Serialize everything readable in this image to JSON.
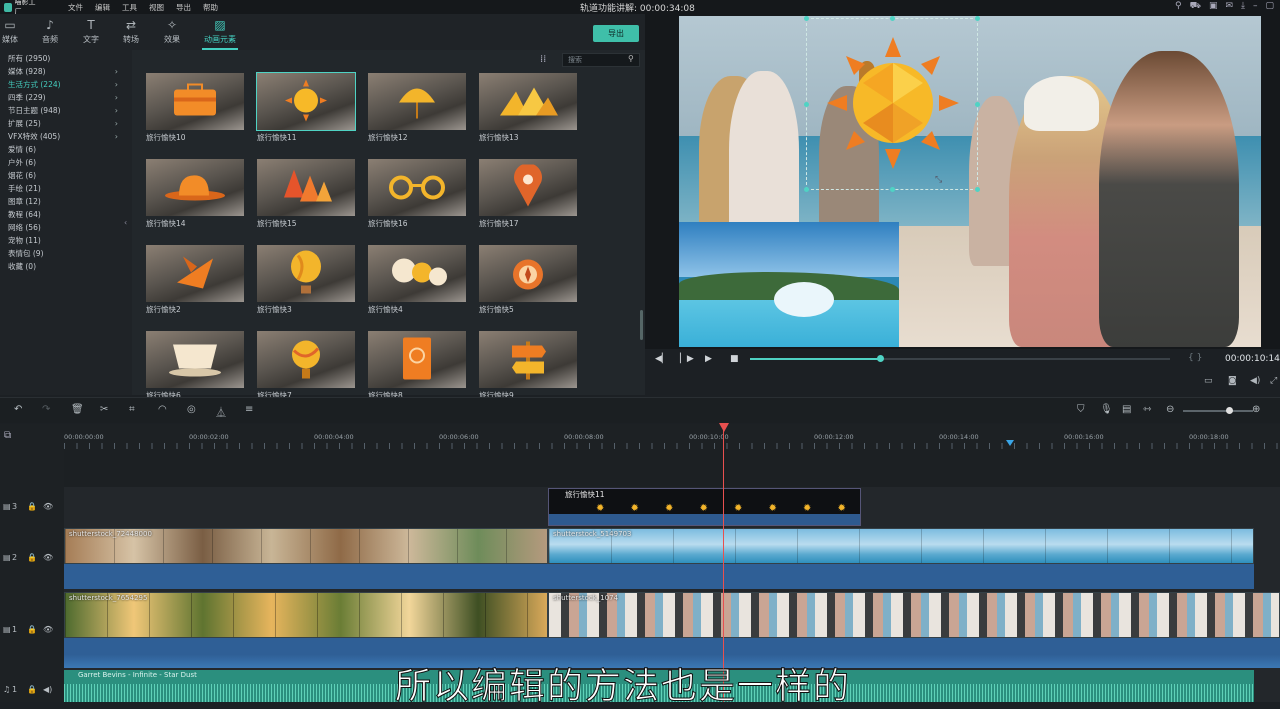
{
  "app": {
    "logo_text": "喵影工厂",
    "menus": [
      "文件",
      "编辑",
      "工具",
      "视图",
      "导出",
      "帮助"
    ],
    "window_title": "轨道功能讲解: 00:00:34:08"
  },
  "tabs": [
    {
      "label": "媒体",
      "icon": "folder-icon"
    },
    {
      "label": "音频",
      "icon": "music-icon"
    },
    {
      "label": "文字",
      "icon": "text-icon"
    },
    {
      "label": "转场",
      "icon": "transition-icon"
    },
    {
      "label": "效果",
      "icon": "effects-icon"
    },
    {
      "label": "动画元素",
      "icon": "elements-icon",
      "active": true
    }
  ],
  "export_label": "导出",
  "categories": [
    {
      "label": "所有 (2950)"
    },
    {
      "label": "媒体 (928)",
      "arrow": true
    },
    {
      "label": "生活方式 (224)",
      "arrow": true,
      "selected": true
    },
    {
      "label": "四季 (229)",
      "arrow": true
    },
    {
      "label": "节日主题 (948)",
      "arrow": true
    },
    {
      "label": "扩展 (25)",
      "arrow": true
    },
    {
      "label": "VFX特效 (405)",
      "arrow": true
    },
    {
      "label": "爱情 (6)"
    },
    {
      "label": "户外 (6)"
    },
    {
      "label": "烟花 (6)"
    },
    {
      "label": "手绘 (21)"
    },
    {
      "label": "图章 (12)"
    },
    {
      "label": "教程 (64)"
    },
    {
      "label": "网络 (56)"
    },
    {
      "label": "宠物 (11)"
    },
    {
      "label": "表情包 (9)"
    },
    {
      "label": "收藏 (0)"
    }
  ],
  "search_placeholder": "搜索",
  "elements": [
    {
      "label": "旅行愉快10",
      "shape": "suitcase"
    },
    {
      "label": "旅行愉快11",
      "shape": "sun",
      "selected": true
    },
    {
      "label": "旅行愉快12",
      "shape": "umbrella"
    },
    {
      "label": "旅行愉快13",
      "shape": "mountains"
    },
    {
      "label": "旅行愉快14",
      "shape": "hat"
    },
    {
      "label": "旅行愉快15",
      "shape": "trees"
    },
    {
      "label": "旅行愉快16",
      "shape": "glasses"
    },
    {
      "label": "旅行愉快17",
      "shape": "pin"
    },
    {
      "label": "旅行愉快2",
      "shape": "plane"
    },
    {
      "label": "旅行愉快3",
      "shape": "balloon"
    },
    {
      "label": "旅行愉快4",
      "shape": "icecream"
    },
    {
      "label": "旅行愉快5",
      "shape": "compass"
    },
    {
      "label": "旅行愉快6",
      "shape": "cup"
    },
    {
      "label": "旅行愉快7",
      "shape": "globe"
    },
    {
      "label": "旅行愉快8",
      "shape": "passport"
    },
    {
      "label": "旅行愉快9",
      "shape": "sign"
    }
  ],
  "playback": {
    "timecode": "00:00:10:14",
    "progress": 0.31
  },
  "ruler": [
    "00:00:00:00",
    "00:00:02:00",
    "00:00:04:00",
    "00:00:06:00",
    "00:00:08:00",
    "00:00:10:00",
    "00:00:12:00",
    "00:00:14:00",
    "00:00:16:00",
    "00:00:18:00"
  ],
  "tracks": [
    {
      "label": "3"
    },
    {
      "label": "2"
    },
    {
      "label": "1"
    },
    {
      "label": "1"
    }
  ],
  "clips": {
    "fx_label": "旅行愉快11",
    "v2a": "shutterstock_72448000",
    "v2b": "shutterstock_5149703",
    "v1a": "shutterstock_7654295",
    "v1b": "shutterstock_1074",
    "audio": "Garret Bevins - Infinite - Star Dust"
  },
  "subtitle": "所以编辑的方法也是一样的",
  "colors": {
    "accent": "#44cfc0",
    "playhead": "#e8504f",
    "sun": "#f3b52b"
  }
}
